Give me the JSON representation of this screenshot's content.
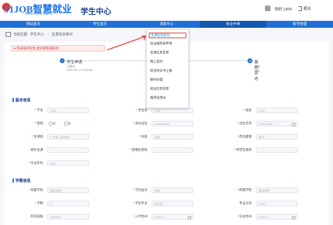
{
  "header": {
    "logo_text": "91JOB智慧就业",
    "logo_url": "www.91job.org.cn",
    "title": "学生中心",
    "greeting": "你好,1906",
    "logout": "退出"
  },
  "nav": [
    "网站首页",
    "学生首页",
    "求职中心",
    "就业手续",
    "账号管理"
  ],
  "breadcrumb": {
    "current_label": "当前位置:",
    "items": [
      "学生中心",
      "生源信息核对"
    ]
  },
  "alert": {
    "text": "● 有未核对信息,请尽快完成核对!"
  },
  "steps": [
    {
      "title": "学生申请",
      "sub1": "已提交",
      "sub2": "2021-06-17 20:48:08"
    },
    {
      "title": "最终状态",
      "sub1": "审核通过"
    }
  ],
  "dropdown": {
    "items": [
      "生源信息核对",
      "就业推荐表申请",
      "生源信息变更",
      "网上签约",
      "就业协议书上报",
      "解约办理",
      "就业信息变更",
      "报到证改派"
    ],
    "active_index": 0
  },
  "sections": {
    "basic_title": "基本信息",
    "academic_title": "学籍信息"
  },
  "basic": {
    "rows": [
      [
        {
          "label": "学号",
          "value": "1906",
          "req": true
        },
        {
          "label": "考生号",
          "value": "1906",
          "req": true
        },
        {
          "label": "姓名",
          "value": "1906",
          "req": true
        }
      ],
      [
        {
          "label": "性别",
          "type": "radio",
          "options": [
            "男",
            "女"
          ],
          "req": true
        },
        {
          "label": "身份证号",
          "value": "4403456789",
          "req": true
        },
        {
          "label": "出生年月",
          "value": "2021/09/06",
          "req": true,
          "cal": true
        }
      ],
      [
        {
          "label": "生源地",
          "value": "广东省 / 深圳市",
          "req": true
        },
        {
          "label": "民族",
          "value": "汉族",
          "req": true
        },
        {
          "label": "政治面貌",
          "value": "群众",
          "req": true
        }
      ],
      [
        {
          "label": "城乡生源",
          "value": "",
          "req": false
        },
        {
          "label": "困难生类别",
          "value": "",
          "req": true
        },
        {
          "label": "师范生类别",
          "value": "",
          "req": true
        }
      ],
      [
        {
          "label": "毕业年份",
          "value": "2022",
          "req": true
        }
      ]
    ]
  },
  "academic": {
    "rows": [
      [
        {
          "label": "所属学校",
          "value": "测试学校",
          "req": true
        },
        {
          "label": "学历层次",
          "value": "本科",
          "req": true
        },
        {
          "label": "所属学院",
          "value": "测试学院",
          "req": true
        }
      ],
      [
        {
          "label": "学制",
          "value": "4",
          "req": true
        },
        {
          "label": "学位专业",
          "value": "哲学类",
          "req": true
        },
        {
          "label": "专业方向",
          "value": "4243",
          "req": false
        }
      ],
      [
        {
          "label": "所在班级",
          "value": "1245234",
          "req": false
        },
        {
          "label": "入学时间",
          "value": "2021/07",
          "req": true,
          "cal": true
        },
        {
          "label": "毕业时间",
          "value": "2021/07",
          "req": true,
          "cal": true
        }
      ]
    ]
  }
}
